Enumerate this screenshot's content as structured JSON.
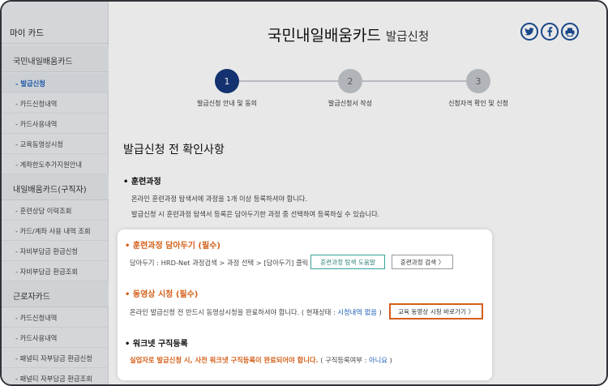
{
  "sidebar": {
    "title": "마이 카드",
    "sections": [
      {
        "label": "국민내일배움카드",
        "items": [
          "- 발급신청",
          "- 카드신청내역",
          "- 카드사용내역",
          "- 교육동영상시청",
          "- 계좌한도추가지원안내"
        ]
      },
      {
        "label": "내일배움카드(구직자)",
        "items": [
          "- 훈련상담 이력조회",
          "- 카드/계좌 사용 내역 조회",
          "- 자비부담금 환급신청",
          "- 자비부담금 환급조회"
        ]
      },
      {
        "label": "근로자카드",
        "items": [
          "- 카드신청내역",
          "- 카드사용내역",
          "- 패널티 자부담금 환급신청",
          "- 패널티 자부담금 환급조회"
        ]
      }
    ]
  },
  "header": {
    "title": "국민내일배움카드",
    "subtitle": "발급신청",
    "share_icons": [
      "twitter-icon",
      "facebook-icon",
      "print-icon"
    ]
  },
  "steps": [
    {
      "num": "1",
      "label": "발급신청 안내 및 동의"
    },
    {
      "num": "2",
      "label": "발급신청서 작성"
    },
    {
      "num": "3",
      "label": "신청자격 확인 및 신청"
    }
  ],
  "main": {
    "section_title": "발급신청 전 확인사항",
    "training": {
      "heading": "• 훈련과정",
      "line1": "온라인 훈련과정 탐색서에 과정을 1개 이상 등록하셔야 합니다.",
      "line2": "발급신청 시 훈련과정 탐색서 등록은 담아두기한 과정 중 선택하여 등록하실 수 있습니다."
    }
  },
  "popup": {
    "basket": {
      "heading": "• 훈련과정 담아두기 (필수)",
      "text": "담아두기 : HRD-Net 과정검색 > 과정 선택 > [담아두기] 클릭",
      "help_button": "훈련과정 탐색 도움말",
      "search_button": "훈련과정 검색 〉"
    },
    "video": {
      "heading": "• 동영상 시청 (필수)",
      "text": "온라인 발급신청 전 반드시 동영상시청을 완료하셔야 합니다. ( 현재상태 : ",
      "status": "시청내역 없음",
      "text_end": " )",
      "button": "교육 동영상 시청 바로가기 〉"
    },
    "worknet": {
      "heading": "• 워크넷 구직등록",
      "warning": "실업자로 발급신청 시, 사전 워크넷 구직등록이 완료되어야 합니다.",
      "text": " ( 구직등록여부 : ",
      "status": "아니요",
      "text_end": " )"
    }
  },
  "colors": {
    "navy": "#17377a",
    "orange": "#d4601a",
    "teal": "#3aa39a",
    "blue": "#1f5fb8"
  }
}
